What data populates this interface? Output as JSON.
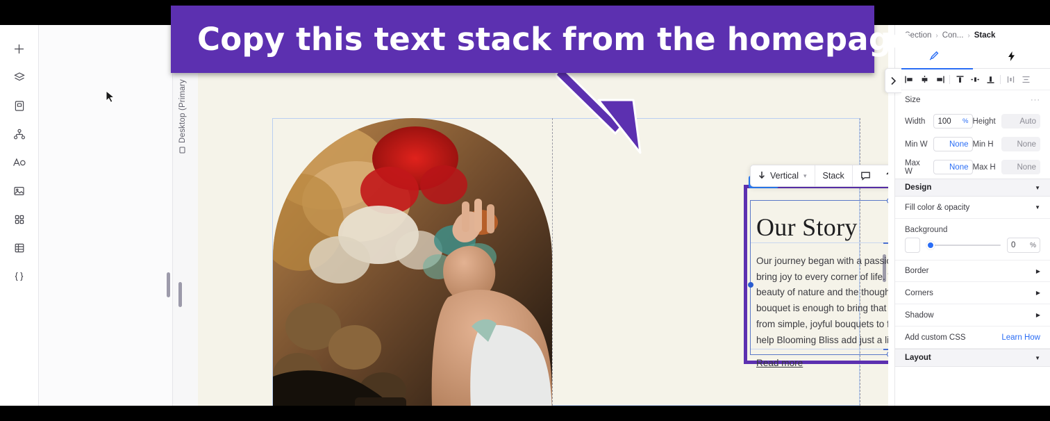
{
  "callout": {
    "text": "Copy this text stack from the homepage",
    "bg_color": "#5C30B0",
    "text_color": "#FFFFFF",
    "arrow_icon": "down-right-arrow-icon"
  },
  "rail": {
    "items": [
      {
        "icon": "plus-icon",
        "label": "Add"
      },
      {
        "icon": "layers-icon",
        "label": "Layers"
      },
      {
        "icon": "page-icon",
        "label": "Pages"
      },
      {
        "icon": "sitemap-icon",
        "label": "Site map"
      },
      {
        "icon": "text-icon",
        "label": "Text"
      },
      {
        "icon": "image-icon",
        "label": "Image"
      },
      {
        "icon": "apps-grid-icon",
        "label": "Apps"
      },
      {
        "icon": "table-icon",
        "label": "Table"
      },
      {
        "icon": "code-braces-icon",
        "label": "Code"
      }
    ]
  },
  "canvas": {
    "device_tab": "Desktop (Primary",
    "device_icon": "monitor-icon",
    "page_background": "#F5F3E9",
    "selection": {
      "badge": "Stack",
      "badge_caret": "‹",
      "badge_color": "#2A7CF7",
      "outline_color": "#5C30B0"
    },
    "content": {
      "heading": "Our Story",
      "body": "Our journey began with a passion for flowers and a dream to bring joy to every corner of life. To us, the combination of the beauty of nature and the thoughtfulness that goes into each bouquet is enough to bring that to each other. We offer everything from simple, joyful bouquets to full arrangements. Join us and help Blooming Bliss add just a little bit of bliss to your story.",
      "link": "Read more"
    },
    "photo_alt": "Florist arranging dried and colorful flowers",
    "decoration": "floral-line-art"
  },
  "element_toolbar": {
    "direction_icon": "arrow-down-icon",
    "direction_label": "Vertical",
    "direction_caret": "chevron-down-icon",
    "stack_label": "Stack",
    "comment_icon": "comment-icon",
    "help_icon": "help-icon",
    "more_icon": "ellipsis-icon"
  },
  "inspector": {
    "breadcrumb": [
      "Section",
      "Con...",
      "Stack"
    ],
    "breadcrumb_sep": "›",
    "tabs": [
      {
        "icon": "brush-icon",
        "name": "design-tab",
        "active": true
      },
      {
        "icon": "lightning-icon",
        "name": "interactions-tab",
        "active": false
      }
    ],
    "align_buttons": [
      "align-left-icon",
      "align-center-horizontal-icon",
      "align-right-icon",
      "align-top-icon",
      "align-middle-vertical-icon",
      "align-bottom-icon",
      "distribute-horizontal-icon",
      "distribute-vertical-icon"
    ],
    "size": {
      "title": "Size",
      "more_icon": "ellipsis-icon",
      "fields": [
        {
          "label": "Width",
          "value": "100",
          "unit": "%",
          "dim": false
        },
        {
          "label": "Height",
          "value": "Auto",
          "unit": "",
          "dim": true
        },
        {
          "label": "Min W",
          "value": "None",
          "unit": "",
          "dim": false
        },
        {
          "label": "Min H",
          "value": "None",
          "unit": "",
          "dim": true
        },
        {
          "label": "Max W",
          "value": "None",
          "unit": "",
          "dim": false
        },
        {
          "label": "Max H",
          "value": "None",
          "unit": "",
          "dim": true
        }
      ]
    },
    "design": {
      "title": "Design",
      "fill_title": "Fill color & opacity",
      "background_label": "Background",
      "background_opacity": "0",
      "background_unit": "%",
      "rows": [
        {
          "label": "Border",
          "name": "border-row"
        },
        {
          "label": "Corners",
          "name": "corners-row"
        },
        {
          "label": "Shadow",
          "name": "shadow-row"
        }
      ],
      "custom_css_label": "Add custom CSS",
      "learn_how_label": "Learn How"
    },
    "layout": {
      "title": "Layout"
    },
    "collapse_icon": "chevron-right-icon",
    "accent_color": "#2A6DF5"
  }
}
